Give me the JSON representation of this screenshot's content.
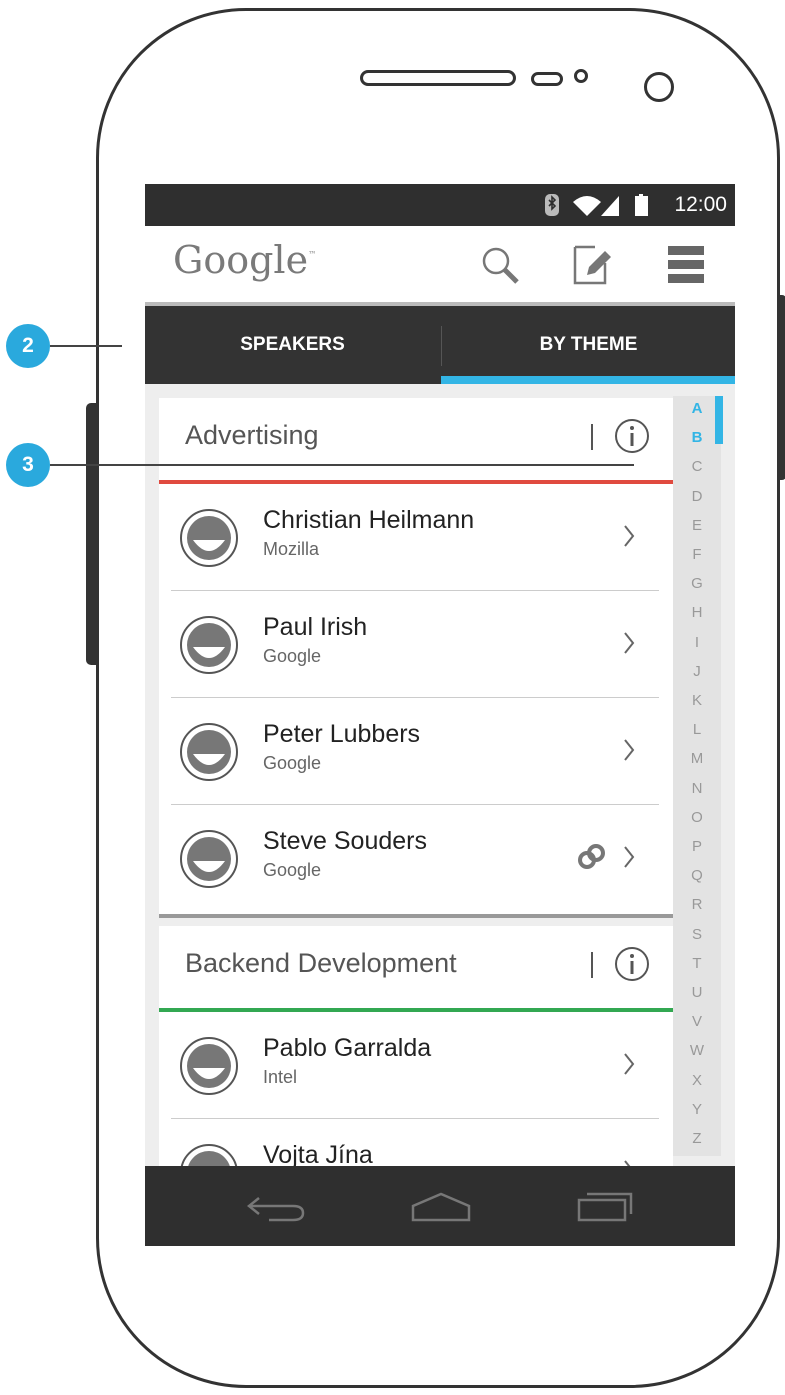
{
  "status_bar": {
    "time": "12:00",
    "icons": [
      "bluetooth-icon",
      "wifi-icon",
      "signal-icon",
      "battery-icon"
    ]
  },
  "action_bar": {
    "logo": "Google",
    "logo_tm": "™",
    "actions": [
      "search-icon",
      "compose-icon",
      "menu-icon"
    ]
  },
  "tabs": [
    {
      "label": "SPEAKERS",
      "selected": false
    },
    {
      "label": "BY THEME",
      "selected": true
    }
  ],
  "sections": [
    {
      "title": "Advertising",
      "accent": "#e04a3f",
      "speakers": [
        {
          "name": "Christian Heilmann",
          "company": "Mozilla",
          "linked": false
        },
        {
          "name": "Paul Irish",
          "company": "Google",
          "linked": false
        },
        {
          "name": "Peter Lubbers",
          "company": "Google",
          "linked": false
        },
        {
          "name": "Steve Souders",
          "company": "Google",
          "linked": true
        }
      ]
    },
    {
      "title": "Backend Development",
      "accent": "#33a852",
      "speakers": [
        {
          "name": "Pablo Garralda",
          "company": "Intel",
          "linked": false
        },
        {
          "name": "Vojta Jína",
          "company": "",
          "linked": false
        }
      ]
    }
  ],
  "alphabet_index": [
    "A",
    "B",
    "C",
    "D",
    "E",
    "F",
    "G",
    "H",
    "I",
    "J",
    "K",
    "L",
    "M",
    "N",
    "O",
    "P",
    "Q",
    "R",
    "S",
    "T",
    "U",
    "V",
    "W",
    "X",
    "Y",
    "Z"
  ],
  "alphabet_active": [
    "A",
    "B"
  ],
  "callouts": [
    {
      "number": "2"
    },
    {
      "number": "3"
    }
  ],
  "colors": {
    "accent_blue": "#33b5e5",
    "dark_bar": "#333333",
    "callout": "#2aa9dd"
  }
}
